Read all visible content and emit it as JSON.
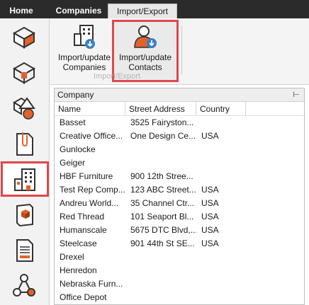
{
  "tabs": {
    "home": "Home",
    "companies": "Companies",
    "import_export": "Import/Export"
  },
  "ribbon": {
    "import_companies": "Import/update\nCompanies",
    "import_contacts": "Import/update\nContacts",
    "group_label": "Import/Export"
  },
  "grid": {
    "title": "Company",
    "pin": "⊢",
    "columns": [
      "Name",
      "Street Address",
      "Country"
    ],
    "rows": [
      [
        "Basset",
        "3525 Fairyston...",
        ""
      ],
      [
        "Creative Office...",
        "One Design Ce...",
        "USA"
      ],
      [
        "Gunlocke",
        "",
        ""
      ],
      [
        "Geiger",
        "",
        ""
      ],
      [
        "HBF Furniture",
        "900 12th Stree...",
        ""
      ],
      [
        "Test Rep Comp...",
        "123 ABC Street...",
        "USA"
      ],
      [
        "Andreu World...",
        "35 Channel Ctr...",
        "USA"
      ],
      [
        "Red Thread",
        "101 Seaport Bl...",
        "USA"
      ],
      [
        "Humanscale",
        "5675 DTC Blvd,...",
        "USA"
      ],
      [
        "Steelcase",
        "901 44th St SE...",
        "USA"
      ],
      [
        "Drexel",
        "",
        ""
      ],
      [
        "Henredon",
        "",
        ""
      ],
      [
        "Nebraska Furn...",
        "",
        ""
      ],
      [
        "Office Depot",
        "",
        ""
      ]
    ]
  },
  "sidebar_icons": [
    "floorplan-icon",
    "floorplan-3d-icon",
    "shapes-icon",
    "document-clip-icon",
    "building-icon",
    "catalog-book-icon",
    "report-icon",
    "network-icon"
  ],
  "colors": {
    "highlight": "#e0474c",
    "accent_orange": "#e2622b",
    "icon_blue": "#3b7fc4"
  }
}
